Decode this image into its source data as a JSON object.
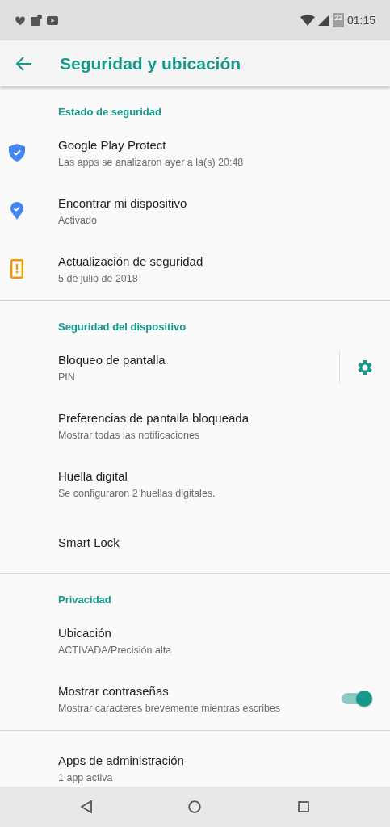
{
  "status_bar": {
    "battery_text": "22",
    "time": "01:15"
  },
  "toolbar": {
    "title": "Seguridad y ubicación"
  },
  "sections": [
    {
      "heading": "Estado de seguridad",
      "items": [
        {
          "kind": "plain",
          "title": "Google Play Protect",
          "summary": "Las apps se analizaron ayer a la(s) 20:48"
        },
        {
          "kind": "plain",
          "title": "Encontrar mi dispositivo",
          "summary": "Activado"
        },
        {
          "kind": "plain",
          "title": "Actualización de seguridad",
          "summary": "5 de julio de 2018"
        }
      ]
    },
    {
      "heading": "Seguridad del dispositivo",
      "items": [
        {
          "kind": "gear",
          "title": "Bloqueo de pantalla",
          "summary": "PIN"
        },
        {
          "kind": "plain",
          "title": "Preferencias de pantalla bloqueada",
          "summary": "Mostrar todas las notificaciones"
        },
        {
          "kind": "plain",
          "title": "Huella digital",
          "summary": "Se configuraron 2 huellas digitales."
        },
        {
          "kind": "plain",
          "title": "Smart Lock"
        }
      ]
    },
    {
      "heading": "Privacidad",
      "items": [
        {
          "kind": "plain",
          "title": "Ubicación",
          "summary": "ACTIVADA/Precisión alta"
        },
        {
          "kind": "toggle",
          "title": "Mostrar contraseñas",
          "summary": "Mostrar caracteres brevemente mientras escribes",
          "on": true
        }
      ]
    },
    {
      "items": [
        {
          "kind": "plain",
          "title": "Apps de administración",
          "summary": "1 app activa"
        }
      ]
    }
  ]
}
